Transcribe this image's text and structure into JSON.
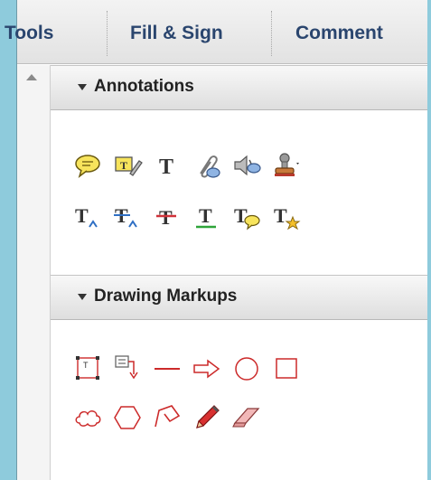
{
  "tabs": [
    {
      "label": "Tools"
    },
    {
      "label": "Fill & Sign"
    },
    {
      "label": "Comment"
    }
  ],
  "sections": {
    "annotations": {
      "title": "Annotations",
      "tools": [
        "sticky-note-icon",
        "highlight-text-icon",
        "add-text-icon",
        "attach-file-icon",
        "record-audio-icon",
        "stamp-icon",
        "insert-text-icon",
        "replace-text-icon",
        "strikethrough-icon",
        "underline-icon",
        "text-comment-icon",
        "text-correction-icon"
      ]
    },
    "drawing": {
      "title": "Drawing Markups",
      "tools": [
        "text-box-icon",
        "text-callout-icon",
        "line-icon",
        "arrow-icon",
        "oval-icon",
        "rectangle-icon",
        "cloud-icon",
        "polygon-icon",
        "connected-lines-icon",
        "pencil-icon",
        "eraser-icon"
      ]
    }
  },
  "colors": {
    "tab_text": "#2a456e",
    "drawing_tool": "#cc2a2a"
  }
}
